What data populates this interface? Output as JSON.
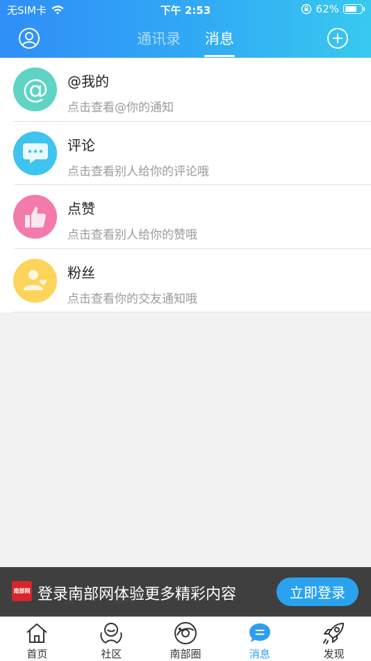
{
  "status_bar": {
    "carrier": "无SIM卡",
    "time": "下午 2:53",
    "battery": "62%"
  },
  "header": {
    "tabs": [
      {
        "label": "通讯录",
        "active": false
      },
      {
        "label": "消息",
        "active": true
      }
    ],
    "left_icon": "profile-icon",
    "right_icon": "add-icon"
  },
  "messages": [
    {
      "title": "@我的",
      "subtitle": "点击查看@你的通知",
      "icon": "at-icon",
      "color": "#5fd3c4"
    },
    {
      "title": "评论",
      "subtitle": "点击查看别人给你的评论哦",
      "icon": "comment-icon",
      "color": "#3fc3ef"
    },
    {
      "title": "点赞",
      "subtitle": "点击查看别人给你的赞哦",
      "icon": "thumbs-up-icon",
      "color": "#f37bab"
    },
    {
      "title": "粉丝",
      "subtitle": "点击查看你的交友通知哦",
      "icon": "fans-icon",
      "color": "#fdd45b"
    }
  ],
  "login_banner": {
    "logo_text": "南部网",
    "text": "登录南部网体验更多精彩内容",
    "button": "立即登录"
  },
  "tab_bar": [
    {
      "label": "首页",
      "icon": "home-icon",
      "active": false
    },
    {
      "label": "社区",
      "icon": "community-icon",
      "active": false
    },
    {
      "label": "南部圈",
      "icon": "circle-icon",
      "active": false
    },
    {
      "label": "消息",
      "icon": "message-icon",
      "active": true
    },
    {
      "label": "发现",
      "icon": "rocket-icon",
      "active": false
    }
  ],
  "colors": {
    "accent": "#2f9df0",
    "banner_bg": "#3f3f3f"
  }
}
